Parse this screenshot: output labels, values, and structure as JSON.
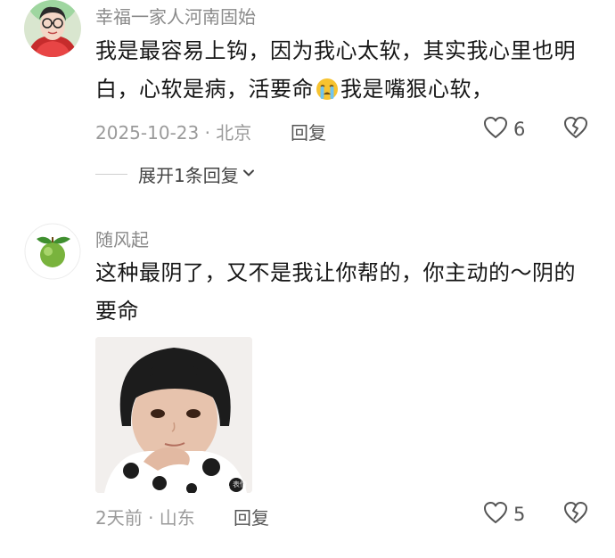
{
  "comments": [
    {
      "username": "幸福一家人河南固始",
      "text_before_emoji": "我是最容易上钩，因为我心太软，其实我心里也明白，心软是病，活要命",
      "emoji": "crying-face",
      "text_after_emoji": "我是嘴狠心软，",
      "meta": "2025-10-23 · 北京",
      "reply_label": "回复",
      "like_count": "6",
      "expand_label": "展开1条回复"
    },
    {
      "username": "随风起",
      "text": "这种最阴了，又不是我让你帮的，你主动的～阴的要命",
      "image_watermark": "可爱人 表情",
      "meta": "2天前 · 山东",
      "reply_label": "回复",
      "like_count": "5"
    }
  ],
  "icons": {
    "like": "heart-outline-icon",
    "dislike": "broken-heart-outline-icon",
    "expand": "chevron-down-icon"
  },
  "colors": {
    "text": "#161616",
    "muted": "#9a9a9a",
    "username": "#8a8a8a"
  }
}
